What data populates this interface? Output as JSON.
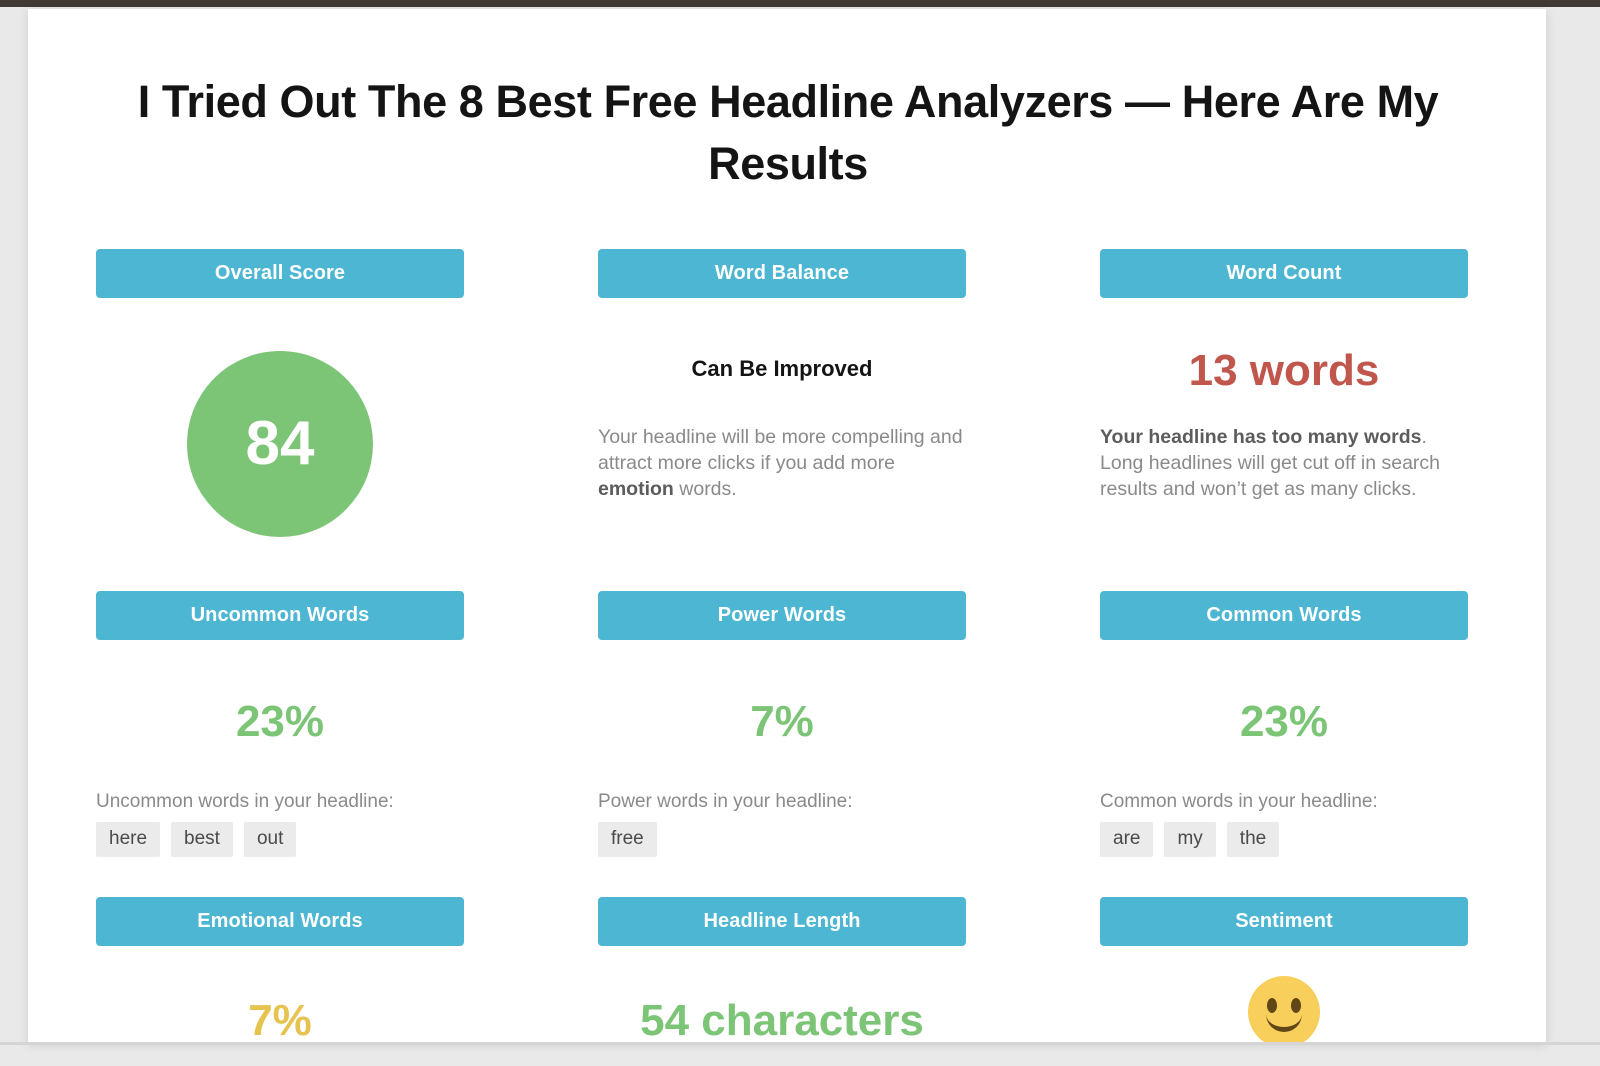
{
  "page": {
    "title": "I Tried Out The 8 Best Free Headline Analyzers — Here Are My Results",
    "accent_color": "#4db6d2",
    "green_color": "#7cc576",
    "red_color": "#c0564c",
    "gold_color": "#e6c24f",
    "chip_color": "#ebebeb"
  },
  "cards": {
    "overall_score": {
      "header": "Overall Score",
      "score": "84"
    },
    "word_balance": {
      "header": "Word Balance",
      "status": "Can Be Improved",
      "desc_pre": "Your headline will be more compelling and attract more clicks if you add more ",
      "desc_bold": "emotion",
      "desc_post": " words."
    },
    "word_count": {
      "header": "Word Count",
      "value": "13 words",
      "desc_bold": "Your headline has too many words",
      "desc_post": ". Long headlines will get cut off in search results and won’t get as many clicks."
    },
    "uncommon_words": {
      "header": "Uncommon Words",
      "value": "23%",
      "caption": "Uncommon words in your headline:",
      "words": [
        "here",
        "best",
        "out"
      ]
    },
    "power_words": {
      "header": "Power Words",
      "value": "7%",
      "caption": "Power words in your headline:",
      "words": [
        "free"
      ]
    },
    "common_words": {
      "header": "Common Words",
      "value": "23%",
      "caption": "Common words in your headline:",
      "words": [
        "are",
        "my",
        "the"
      ]
    },
    "emotional_words": {
      "header": "Emotional Words",
      "value": "7%"
    },
    "headline_length": {
      "header": "Headline Length",
      "value": "54 characters"
    },
    "sentiment": {
      "header": "Sentiment",
      "emoji_name": "smiling-face-icon"
    }
  }
}
